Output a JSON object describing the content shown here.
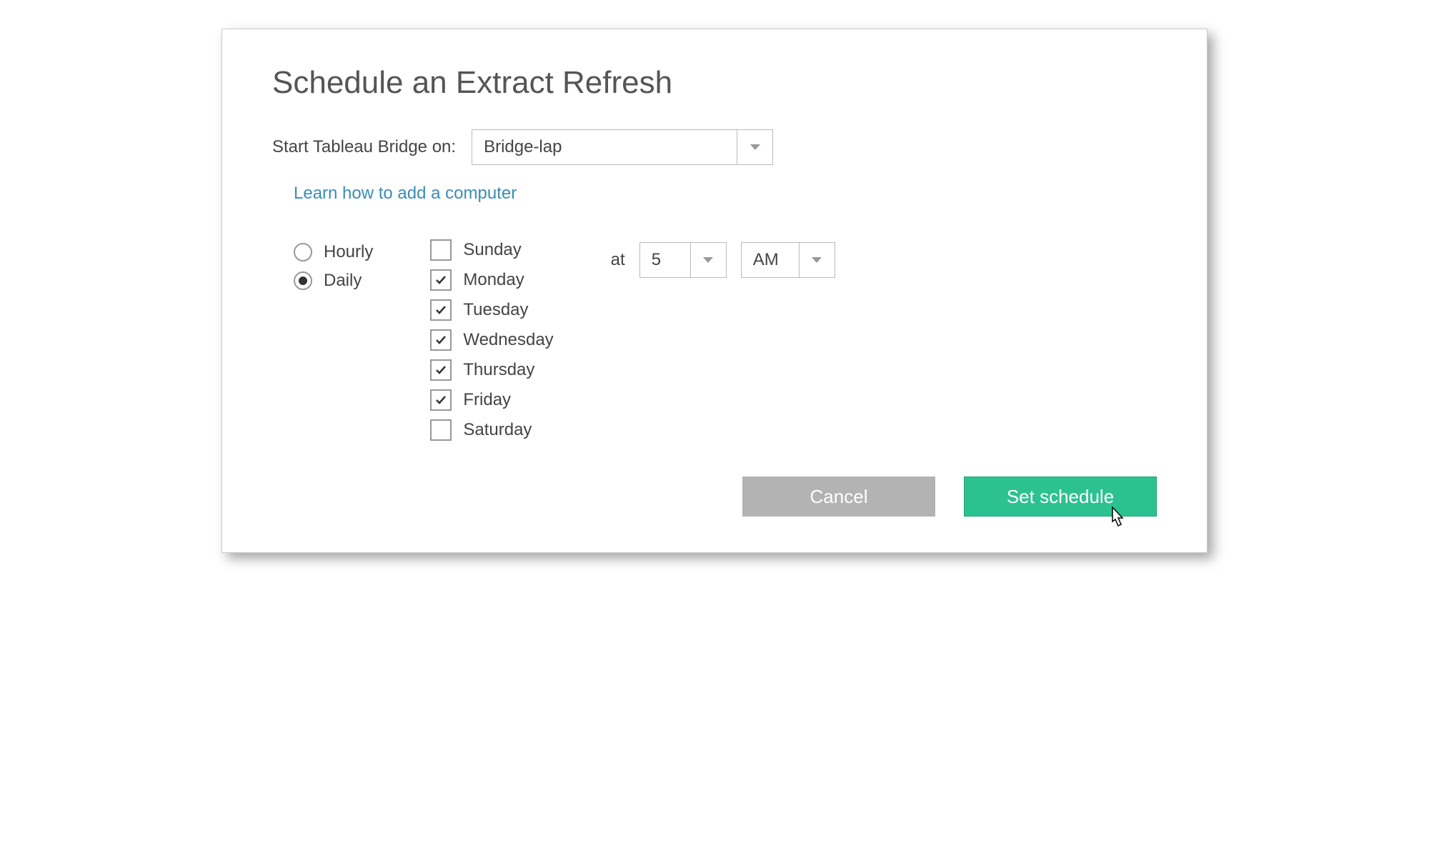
{
  "title": "Schedule an Extract Refresh",
  "bridge": {
    "label": "Start Tableau Bridge on:",
    "selected": "Bridge-lap"
  },
  "learn_link": "Learn how to add a computer",
  "frequency": {
    "options": [
      {
        "label": "Hourly",
        "selected": false
      },
      {
        "label": "Daily",
        "selected": true
      }
    ]
  },
  "days": [
    {
      "label": "Sunday",
      "checked": false
    },
    {
      "label": "Monday",
      "checked": true
    },
    {
      "label": "Tuesday",
      "checked": true
    },
    {
      "label": "Wednesday",
      "checked": true
    },
    {
      "label": "Thursday",
      "checked": true
    },
    {
      "label": "Friday",
      "checked": true
    },
    {
      "label": "Saturday",
      "checked": false
    }
  ],
  "time": {
    "at_label": "at",
    "hour": "5",
    "ampm": "AM"
  },
  "buttons": {
    "cancel": "Cancel",
    "set": "Set schedule"
  }
}
